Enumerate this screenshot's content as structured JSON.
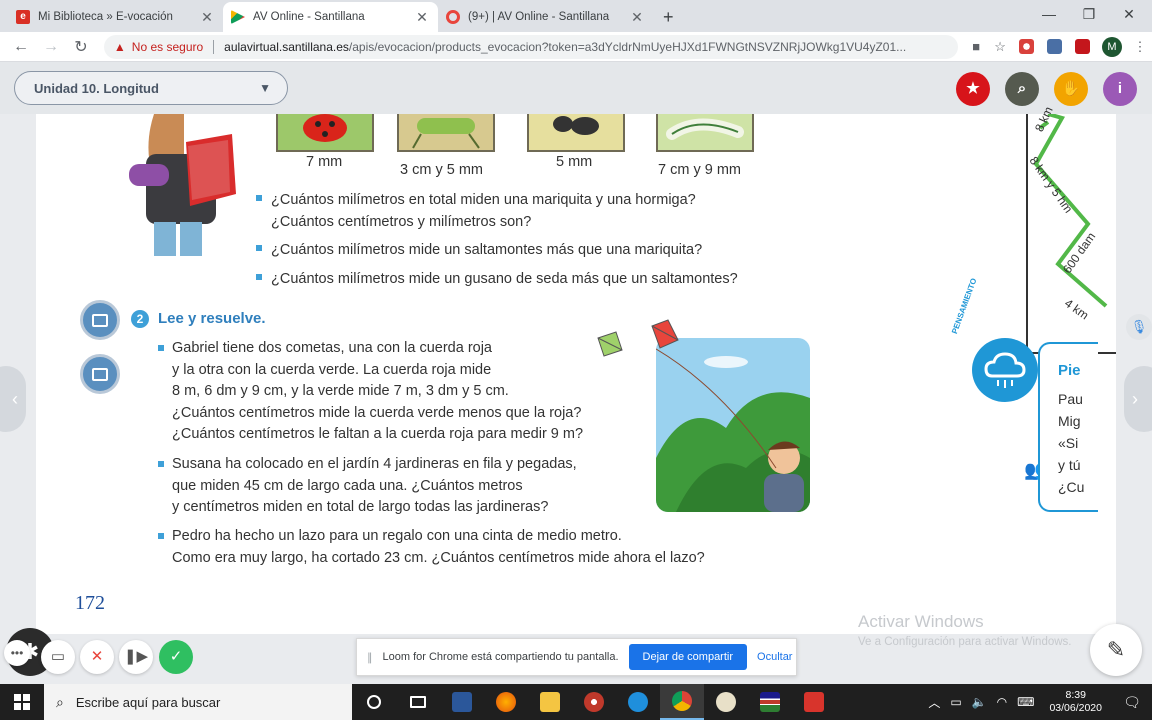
{
  "browser": {
    "tabs": [
      {
        "title": "Mi Biblioteca » E-vocación",
        "color": "#d93025",
        "active": false
      },
      {
        "title": "AV Online - Santillana",
        "color": "#f4b400",
        "active": true
      },
      {
        "title": "(9+) | AV Online - Santillana",
        "color": "#e8453c",
        "active": false
      }
    ],
    "newtab": "+",
    "security_label": "No es seguro",
    "url_host": "aulavirtual.santillana.es",
    "url_path": "/apis/evocacion/products_evocacion?token=a3dYcldrNmUyeHJXd1FWNGtNSVZNRjJOWkg1VU4yZ01...",
    "profile_initial": "M"
  },
  "app": {
    "unit_selector": "Unidad 10. Longitud",
    "accent_colors": {
      "star": "#d7141a",
      "search": "#555a4f",
      "hand": "#f2a400",
      "info": "#9b59b6"
    }
  },
  "page": {
    "measurements": [
      "7 mm",
      "3 cm y 5 mm",
      "5 mm",
      "7 cm y 9 mm"
    ],
    "questions_top": [
      [
        "¿Cuántos milímetros en total miden una mariquita y una hormiga?",
        "¿Cuántos centímetros y milímetros son?"
      ],
      [
        "¿Cuántos milímetros mide un saltamontes más que una mariquita?"
      ],
      [
        "¿Cuántos milímetros mide un gusano de seda más que un saltamontes?"
      ]
    ],
    "section_number": "2",
    "section_title": "Lee y resuelve.",
    "problems": [
      [
        "Gabriel tiene dos cometas, una con la cuerda roja",
        "y la otra con la cuerda verde. La cuerda roja mide",
        "8 m, 6 dm y 9 cm, y la verde mide 7 m, 3 dm y 5 cm.",
        "¿Cuántos centímetros mide la cuerda verde menos que la roja?",
        "¿Cuántos centímetros le faltan a la cuerda roja para medir 9 m?"
      ],
      [
        "Susana ha colocado en el jardín 4 jardineras en fila y pegadas,",
        "que miden 45 cm de largo cada una. ¿Cuántos metros",
        "y centímetros miden en total de largo todas las jardineras?"
      ],
      [
        "Pedro ha hecho un lazo para un regalo con una cinta de medio metro.",
        "Como era muy largo, ha cortado 23 cm. ¿Cuántos centímetros mide ahora el lazo?"
      ]
    ],
    "page_number": "172",
    "map_labels": [
      "8 km",
      "8 km y 5 hm",
      "600 dam",
      "4 km"
    ],
    "thinking_label": "PENSAMIENTO",
    "side_card": {
      "title": "Pie",
      "lines": [
        "Pau",
        "Mig",
        "«Si",
        "y tú",
        "¿Cu"
      ]
    }
  },
  "watermark": {
    "line1": "Activar Windows",
    "line2": "Ve a Configuración para activar Windows."
  },
  "loom": {
    "message": "Loom for Chrome está compartiendo tu pantalla.",
    "share_button": "Dejar de compartir",
    "hide_button": "Ocultar"
  },
  "taskbar": {
    "search_placeholder": "Escribe aquí para buscar",
    "time": "8:39",
    "date": "03/06/2020"
  }
}
